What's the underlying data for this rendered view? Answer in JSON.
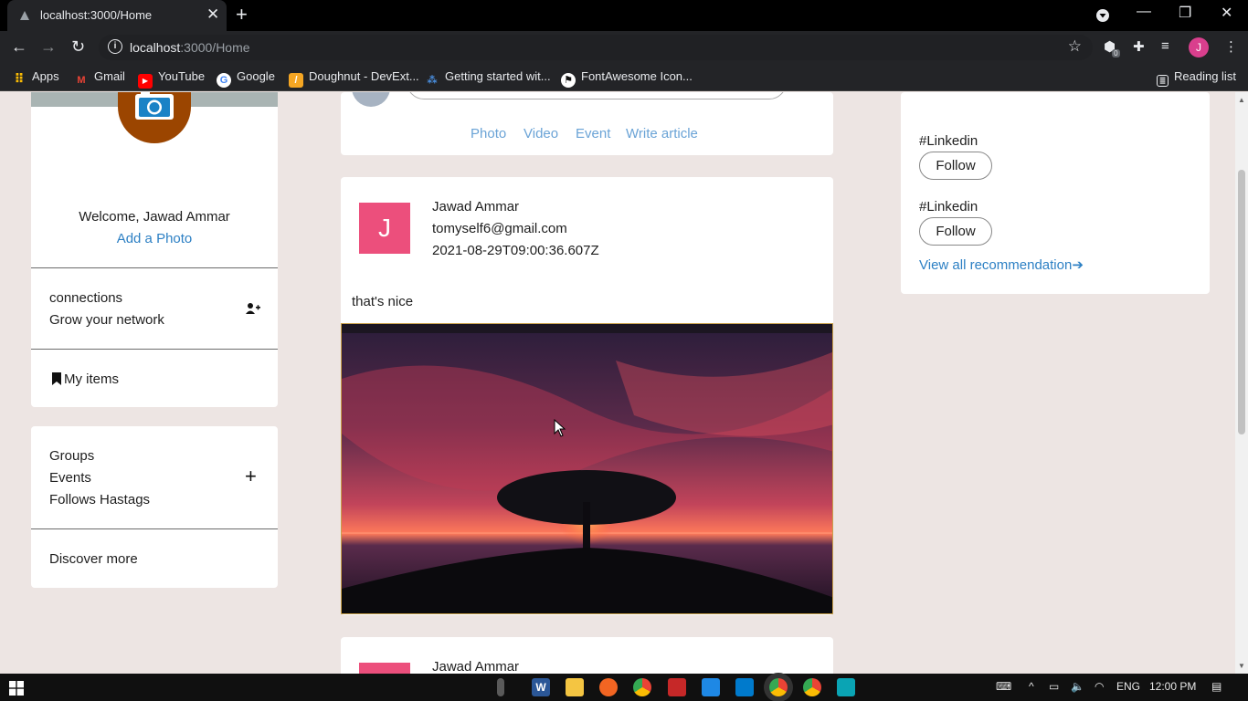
{
  "browser": {
    "tab_title": "localhost:3000/Home",
    "url_host": "localhost",
    "url_path": ":3000/Home",
    "bookmarks": [
      "Apps",
      "Gmail",
      "YouTube",
      "Google",
      "Doughnut - DevExt...",
      "Getting started wit...",
      "FontAwesome Icon..."
    ],
    "reading_list": "Reading list",
    "profile_initial": "J",
    "extension_badge": "0"
  },
  "left": {
    "welcome": "Welcome, Jawad Ammar",
    "add_photo": "Add a Photo",
    "connections": "connections",
    "grow": "Grow your network",
    "my_items": "My items",
    "groups": "Groups",
    "events": "Events",
    "follows": "Follows Hastags",
    "discover": "Discover more"
  },
  "composer": {
    "photo": "Photo",
    "video": "Video",
    "event": "Event",
    "article": "Write article"
  },
  "post": {
    "avatar_initial": "J",
    "name": "Jawad Ammar",
    "email": "tomyself6@gmail.com",
    "date": "2021-08-29T09:00:36.607Z",
    "text": "that's nice"
  },
  "post2": {
    "name": "Jawad Ammar"
  },
  "right": {
    "hashtag1": "#Linkedin",
    "hashtag2": "#Linkedin",
    "follow": "Follow",
    "view_all": "View all recommendation"
  },
  "taskbar": {
    "lang": "ENG",
    "time": "12:00 PM"
  },
  "colors": {
    "page_bg": "#ede5e3",
    "link": "#2d80c4",
    "avatar": "#ec4f7c"
  }
}
